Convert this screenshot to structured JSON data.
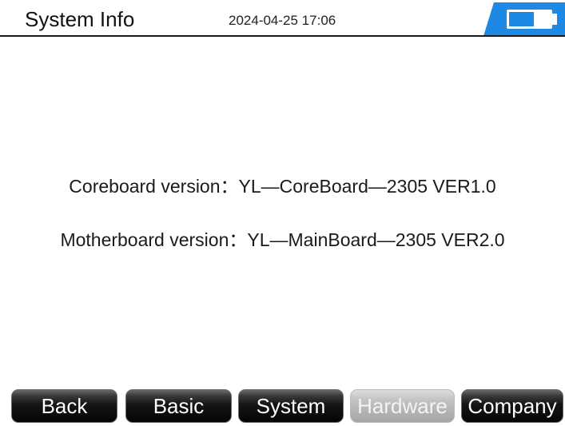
{
  "header": {
    "title": "System Info",
    "datetime": "2024-04-25 17:06",
    "battery_icon": "battery-icon"
  },
  "main": {
    "coreboard": "Coreboard version：YL—CoreBoard—2305 VER1.0",
    "motherboard": "Motherboard version：YL—MainBoard—2305 VER2.0"
  },
  "tabs": [
    {
      "label": "Back"
    },
    {
      "label": "Basic"
    },
    {
      "label": "System"
    },
    {
      "label": "Hardware"
    },
    {
      "label": "Company"
    }
  ],
  "active_tab": "Hardware",
  "colors": {
    "accent": "#1e88e5",
    "tab_dark": "#0a0a0a",
    "tab_active": "#b9b9b9"
  }
}
